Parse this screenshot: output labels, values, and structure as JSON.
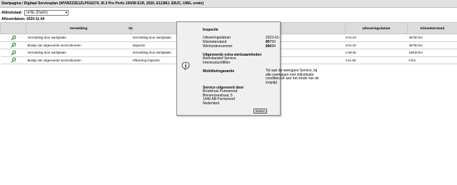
{
  "breadcrumb": "Startpagina / Digitaal Serviceplan (WVWZZZE1ZLP016274, ID.3 Pro Perfo 150/58 E1R, 2020, E113MJ, EBJC, UMG, erwin)",
  "language": {
    "label": "Afdrukstaal:",
    "selected": "nl-NL (Dutch)"
  },
  "afleverdatum": "Afleverdatum: 2020-11-04",
  "table": {
    "headers": [
      "",
      "Vermelding",
      "Se",
      "",
      "Uitvoeringsdatum",
      "Kilometerstand"
    ],
    "rows": [
      {
        "vermelding": "Vermelding door werkplaats",
        "service": "Vermelding door werkplaats",
        "date": "3-01-23",
        "km": "45750 km"
      },
      {
        "vermelding": "Bewijs van uitgevoerde servicebeurten",
        "service": "Inspectie",
        "date": "3-01-20",
        "km": "45750 km"
      },
      {
        "vermelding": "Vermelding door werkplaats",
        "service": "Vermelding door werkplaats",
        "date": "1-09-25",
        "km": "16818 km"
      },
      {
        "vermelding": "Bewijs van uitgevoerde servicebeurten",
        "service": "Aflevering Inspectie",
        "date": "0-11-05",
        "km": "0 km"
      }
    ]
  },
  "dialog": {
    "title": "Inspectie",
    "fields": [
      {
        "label": "Uitvoeringsdatum",
        "value": "2023-01-20"
      },
      {
        "label": "Kilometerstand",
        "value": "45750 km"
      },
      {
        "label": "Werkordernummer",
        "value": "29384"
      }
    ],
    "extra_title": "Uitgevoerde extra werkzaamheden",
    "extra_items": [
      "Reinvloeistof Service",
      "Interieurluchtfilter"
    ],
    "warranty_title": "Mobiliteitsgarantie",
    "warranty_text": "Tot aan de weergave Service, bij alle voertuigen met individuele condities tot aan het einde van de looptijd",
    "dealer_title": "Service uitgevoerd door",
    "dealer_lines": [
      "Broekhuis Purmerend",
      "Binnenzeestraat, 5",
      "1446 AB Purmerend",
      "Nederland"
    ],
    "close_label": "Sluiten"
  },
  "icons": {
    "row": "magnifier-icon",
    "dialog": "info-icon"
  }
}
